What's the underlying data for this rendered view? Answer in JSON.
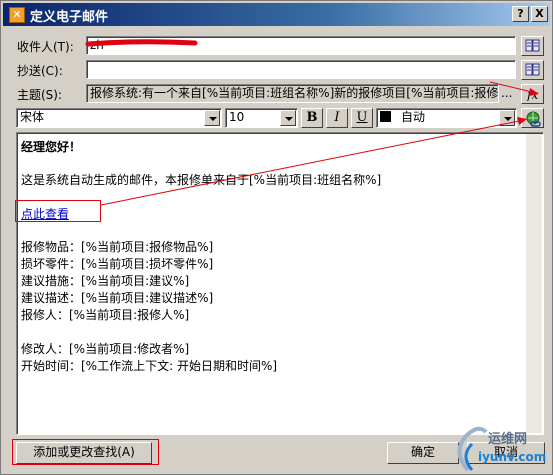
{
  "window": {
    "title": "定义电子邮件",
    "help_label": "?",
    "close_label": "X"
  },
  "recipient": {
    "label": "收件人(T):",
    "value": "zh"
  },
  "cc": {
    "label": "抄送(C):",
    "value": ""
  },
  "subject": {
    "label": "主题(S):",
    "value": "报修系统:有一个来自[%当前项目:班组名称%]新的报修项目[%当前项目:报修物"
  },
  "subject_more_label": "...",
  "toolbar": {
    "font_name": "宋体",
    "font_size": "10",
    "bold_label": "B",
    "italic_label": "I",
    "underline_label": "U",
    "color_label": "自动",
    "color_swatch": "#000000"
  },
  "body_lines": [
    "经理您好！",
    "这是系统自动生成的邮件，本报修单来自于[%当前项目:班组名称%]",
    "点此查看",
    "报修物品：[%当前项目:报修物品%]",
    "损坏零件：[%当前项目:损坏零件%]",
    "建议措施：[%当前项目:建议%]",
    "建议描述：[%当前项目:建议描述%]",
    "报修人：[%当前项目:报修人%]",
    "修改人：[%当前项目:修改者%]",
    "开始时间：[%工作流上下文: 开始日期和时间%]"
  ],
  "buttons": {
    "add_or_change": "添加或更改查找(A)",
    "ok": "确定",
    "cancel": "取消"
  },
  "watermark": {
    "line1": "运维网",
    "line2": "iyunv.com"
  }
}
